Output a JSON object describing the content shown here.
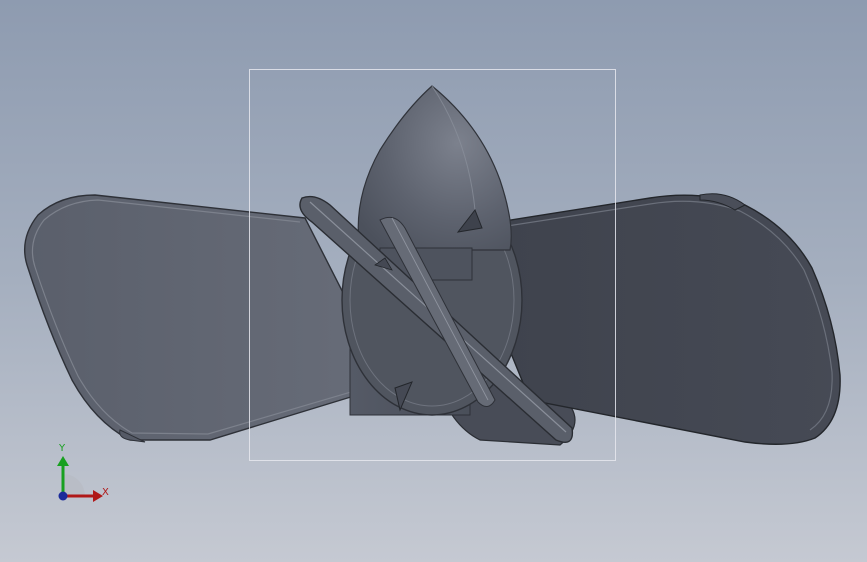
{
  "viewport": {
    "background_top": "#8e9bb0",
    "background_bottom": "#c5c9d2",
    "model": "propeller",
    "blade_count": 4
  },
  "triad": {
    "x_label": "X",
    "y_label": "Y",
    "x_color": "#b01818",
    "y_color": "#18a020",
    "z_color": "#1a2a9a"
  }
}
